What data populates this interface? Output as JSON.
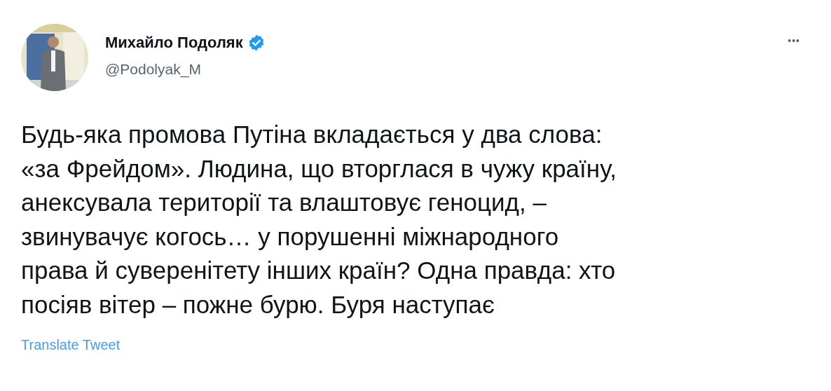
{
  "author": {
    "name": "Михайло Подоляк",
    "verified": true,
    "handle": "@Podolyak_M"
  },
  "more_menu": "•••",
  "tweet_text": "Будь-яка промова Путіна вкладається у два слова:\n«за Фрейдом». Людина, що вторглася в чужу країну,\nанексувала території та влаштовує геноцид, –\nзвинувачує когось… у порушенні міжнародного\nправа й суверенітету інших країн? Одна правда: хто\nпосіяв вітер – пожне бурю. Буря наступає",
  "translate_link": "Translate Tweet"
}
